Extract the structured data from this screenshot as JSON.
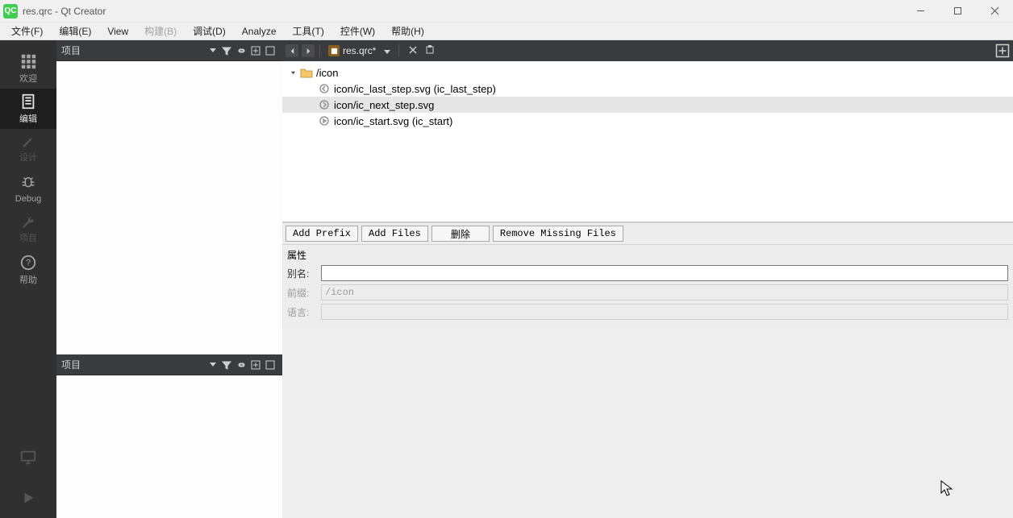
{
  "window": {
    "title": "res.qrc - Qt Creator"
  },
  "menu": {
    "file": "文件(F)",
    "edit": "编辑(E)",
    "view": "View",
    "build": "构建(B)",
    "debug": "调试(D)",
    "analyze": "Analyze",
    "tools": "工具(T)",
    "widgets": "控件(W)",
    "help": "帮助(H)"
  },
  "modes": {
    "welcome": "欢迎",
    "edit": "编辑",
    "design": "设计",
    "debug": "Debug",
    "projects": "项目",
    "help": "帮助"
  },
  "panels": {
    "project_upper": "项目",
    "project_lower": "项目"
  },
  "open_file": {
    "name": "res.qrc*"
  },
  "resource_tree": {
    "prefix": "/icon",
    "items": [
      {
        "label": "icon/ic_last_step.svg (ic_last_step)",
        "selected": false,
        "icon": "back"
      },
      {
        "label": "icon/ic_next_step.svg",
        "selected": true,
        "icon": "forward"
      },
      {
        "label": "icon/ic_start.svg (ic_start)",
        "selected": false,
        "icon": "play"
      }
    ]
  },
  "buttons": {
    "add_prefix": "Add Prefix",
    "add_files": "Add Files",
    "delete": "删除",
    "remove_missing": "Remove Missing Files"
  },
  "props": {
    "title": "属性",
    "alias_label": "别名:",
    "alias_value": "",
    "prefix_label": "前缀:",
    "prefix_value": "/icon",
    "lang_label": "语言:",
    "lang_value": ""
  }
}
